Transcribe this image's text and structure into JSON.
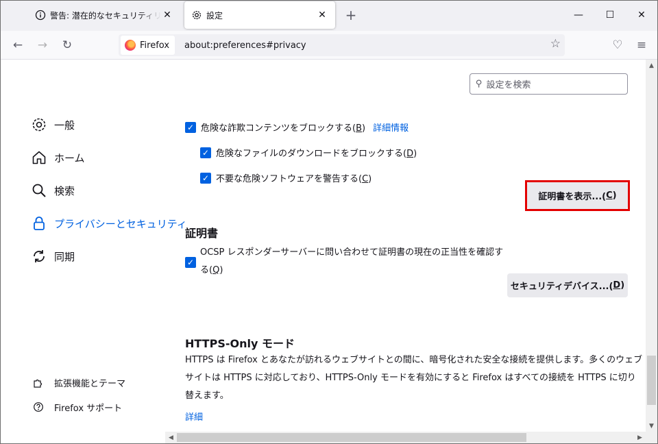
{
  "tabs": [
    {
      "label": "警告: 潜在的なセキュリティリスクあり",
      "icon": "info-icon",
      "close": "✕"
    },
    {
      "label": "設定",
      "icon": "gear-icon",
      "close": "✕"
    }
  ],
  "window_controls": {
    "minimize": "—",
    "maximize": "☐",
    "close": "✕",
    "new_tab": "+"
  },
  "navbar": {
    "back": "←",
    "forward": "→",
    "reload": "↻",
    "identity_label": "Firefox",
    "url": "about:preferences#privacy",
    "bookmark": "☆",
    "pocket": "♡",
    "menu": "≡"
  },
  "search": {
    "placeholder": "設定を検索"
  },
  "sidebar": {
    "items": [
      {
        "label": "一般",
        "icon": "gear-icon",
        "glyph": "⚙"
      },
      {
        "label": "ホーム",
        "icon": "home-icon",
        "glyph": "⌂"
      },
      {
        "label": "検索",
        "icon": "search-icon",
        "glyph": "⌕"
      },
      {
        "label": "プライバシーとセキュリティ",
        "icon": "lock-icon",
        "glyph": "🔒",
        "selected": true
      },
      {
        "label": "同期",
        "icon": "sync-icon",
        "glyph": "⟳"
      }
    ],
    "footer": [
      {
        "label": "拡張機能とテーマ",
        "icon": "puzzle-icon",
        "glyph": "✣"
      },
      {
        "label": "Firefox サポート",
        "icon": "help-icon",
        "glyph": "?"
      }
    ]
  },
  "protection": {
    "block_deceptive": {
      "text": "危険な詐欺コンテンツをブロックする(",
      "key": "B",
      "suffix": ")",
      "checked": true
    },
    "learn_more": "詳細情報",
    "block_downloads": {
      "text": "危険なファイルのダウンロードをブロックする(",
      "key": "D",
      "suffix": ")",
      "checked": true
    },
    "warn_unwanted": {
      "text": "不要な危険ソフトウェアを警告する(",
      "key": "C",
      "suffix": ")",
      "checked": true
    }
  },
  "certificates": {
    "heading": "証明書",
    "ocsp_line1": "OCSP レスポンダーサーバーに問い合わせて証明書の現在の正当性を確認す",
    "ocsp_line2_pre": "る(",
    "ocsp_key": "Q",
    "ocsp_suffix": ")",
    "ocsp_checked": true,
    "view_button": {
      "text": "証明書を表示...(",
      "key": "C",
      "suffix": ")"
    },
    "devices_button": {
      "text": "セキュリティデバイス...(",
      "key": "D",
      "suffix": ")"
    }
  },
  "https_only": {
    "heading": "HTTPS-Only モード",
    "lines": [
      "HTTPS は Firefox とあなたが訪れるウェブサイトとの間に、暗号化された安全な接続を提供します。多くのウェブ",
      "サイトは HTTPS に対応しており、HTTPS-Only モードを有効にすると Firefox はすべての接続を HTTPS に切り",
      "替えます。"
    ],
    "learn_more": "詳細"
  },
  "colors": {
    "accent": "#0061e0",
    "highlight": "#e30000"
  }
}
